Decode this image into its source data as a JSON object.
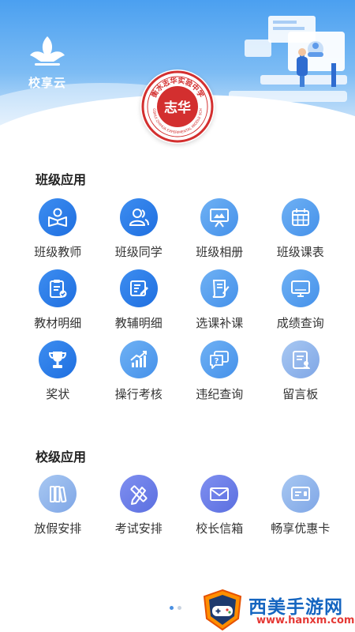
{
  "brand": {
    "name": "校享云"
  },
  "seal": {
    "text": "衡水志华实验中学",
    "center": "志华",
    "ring_en": "HENGSHUI ZHIHUA EXPERIMENTAL MIDDLE SCHOOL"
  },
  "class_apps": {
    "title": "班级应用",
    "items": [
      {
        "label": "班级教师",
        "icon": "teacher-book-icon"
      },
      {
        "label": "班级同学",
        "icon": "classmates-icon"
      },
      {
        "label": "班级相册",
        "icon": "album-board-icon"
      },
      {
        "label": "班级课表",
        "icon": "calendar-icon"
      },
      {
        "label": "教材明细",
        "icon": "clipboard-check-icon"
      },
      {
        "label": "教辅明细",
        "icon": "document-edit-icon"
      },
      {
        "label": "选课补课",
        "icon": "scroll-pen-icon"
      },
      {
        "label": "成绩查询",
        "icon": "monitor-icon"
      },
      {
        "label": "奖状",
        "icon": "trophy-icon"
      },
      {
        "label": "操行考核",
        "icon": "growth-chart-icon"
      },
      {
        "label": "违纪查询",
        "icon": "question-chat-icon"
      },
      {
        "label": "留言板",
        "icon": "message-board-icon"
      }
    ]
  },
  "school_apps": {
    "title": "校级应用",
    "items": [
      {
        "label": "放假安排",
        "icon": "books-icon"
      },
      {
        "label": "考试安排",
        "icon": "pencil-ruler-icon"
      },
      {
        "label": "校长信箱",
        "icon": "mail-icon"
      },
      {
        "label": "畅享优惠卡",
        "icon": "card-icon"
      }
    ]
  },
  "pager": {
    "count": 2,
    "active": 0
  },
  "watermark": {
    "title": "西美手游网",
    "url": "www.hanxm.com"
  },
  "colors": {
    "primary": "#2f80ed",
    "header_top": "#4ba0f0"
  }
}
